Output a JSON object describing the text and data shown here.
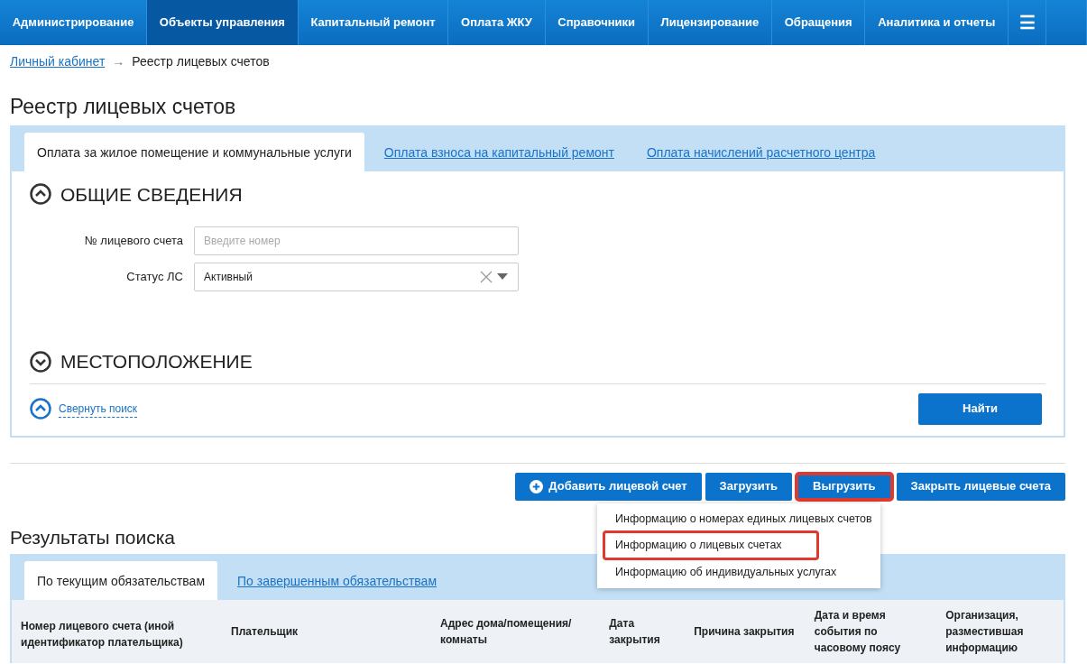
{
  "nav": {
    "items": [
      {
        "label": "Администрирование",
        "selected": false
      },
      {
        "label": "Объекты управления",
        "selected": true
      },
      {
        "label": "Капитальный ремонт",
        "selected": false
      },
      {
        "label": "Оплата ЖКУ",
        "selected": false
      },
      {
        "label": "Справочники",
        "selected": false
      },
      {
        "label": "Лицензирование",
        "selected": false
      },
      {
        "label": "Обращения",
        "selected": false
      },
      {
        "label": "Аналитика и отчеты",
        "selected": false
      }
    ],
    "menu_glyph": "☰"
  },
  "breadcrumb": {
    "link": "Личный кабинет",
    "separator": "→",
    "current": "Реестр лицевых счетов"
  },
  "page_title": "Реестр лицевых счетов",
  "search": {
    "tabs": [
      {
        "label": "Оплата за жилое помещение и коммунальные услуги",
        "selected": true
      },
      {
        "label": "Оплата взноса на капитальный ремонт",
        "selected": false
      },
      {
        "label": "Оплата начислений расчетного центра",
        "selected": false
      }
    ],
    "sections": [
      {
        "title": "ОБЩИЕ СВЕДЕНИЯ",
        "expanded": true,
        "fields": [
          {
            "kind": "text",
            "label": "№ лицевого счета",
            "placeholder": "Введите номер"
          },
          {
            "kind": "select",
            "label": "Статус ЛС",
            "value": "Активный"
          }
        ]
      },
      {
        "title": "МЕСТОПОЛОЖЕНИЕ",
        "expanded": false
      }
    ],
    "collapse_link": "Свернуть поиск",
    "find_button": "Найти"
  },
  "actions": [
    {
      "label": "Добавить лицевой счет",
      "kind": "add",
      "highlighted": false
    },
    {
      "label": "Загрузить",
      "kind": "plain",
      "highlighted": false
    },
    {
      "label": "Выгрузить",
      "kind": "plain",
      "highlighted": true,
      "menu": [
        {
          "label": "Информацию о номерах единых лицевых счетов",
          "highlighted": false
        },
        {
          "label": "Информацию о лицевых счетах",
          "highlighted": true
        },
        {
          "label": "Информацию об индивидуальных услугах",
          "highlighted": false
        }
      ]
    },
    {
      "label": "Закрыть лицевые счета",
      "kind": "plain",
      "highlighted": false
    }
  ],
  "results": {
    "title": "Результаты поиска",
    "tabs": [
      {
        "label": "По текущим обязательствам",
        "selected": true
      },
      {
        "label": "По завершенным обязательствам",
        "selected": false
      }
    ],
    "columns": [
      "Номер лицевого счета (иной идентификатор плательщика)",
      "Плательщик",
      "Адрес дома/помещения/ комнаты",
      "Дата закрытия",
      "Причина закрытия",
      "Дата и время события по часовому поясу",
      "Организация, разместившая информацию"
    ]
  }
}
